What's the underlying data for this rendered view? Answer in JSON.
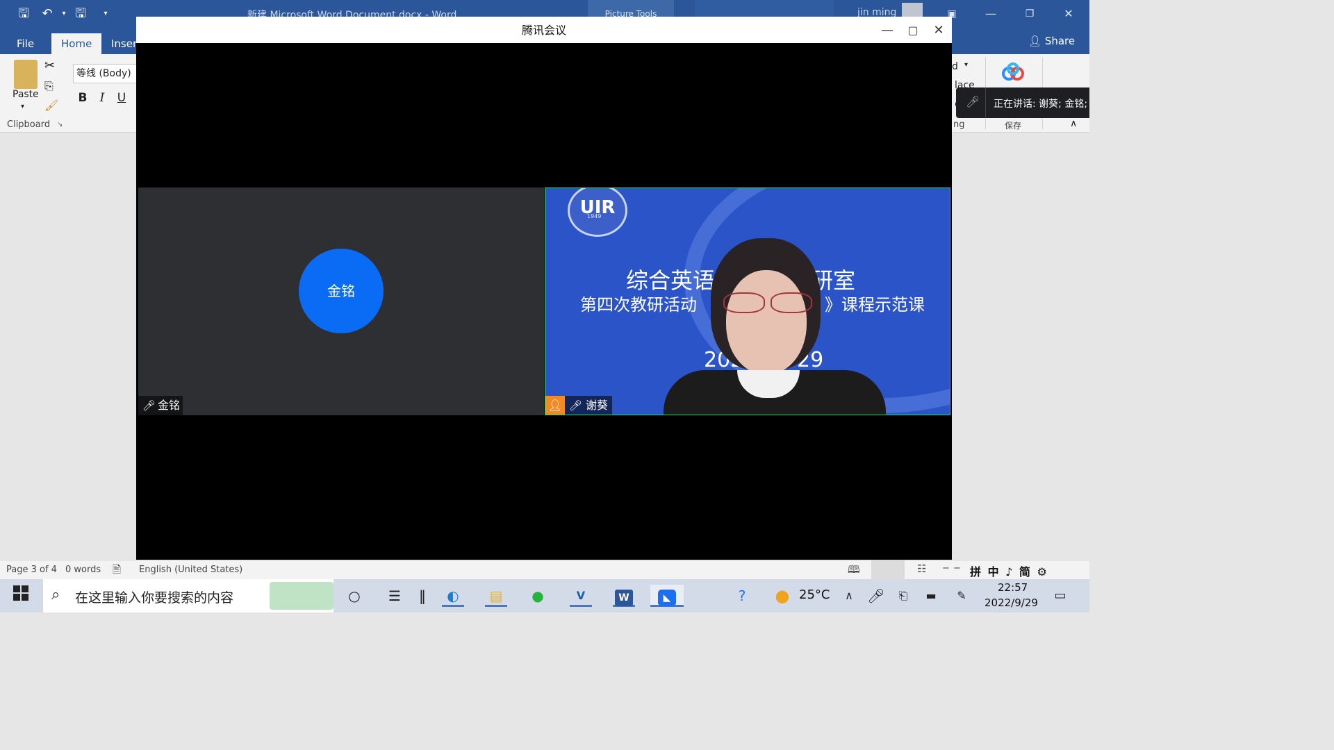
{
  "word": {
    "title": "新建 Microsoft Word Document.docx  -  Word",
    "picture_tools": "Picture Tools",
    "user": "jin ming",
    "tabs": [
      "File",
      "Home",
      "Insert"
    ],
    "share": "Share",
    "paste": "Paste",
    "font_name": "等线 (Body)",
    "bold": "B",
    "italic": "I",
    "underline": "U",
    "clipboard_group": "Clipboard",
    "ribbon_right_fragments": [
      "d",
      "lace",
      "e",
      "ng"
    ],
    "save_cloud": "保存"
  },
  "meeting": {
    "title": "腾讯会议",
    "speaking": "正在讲话: 谢葵; 金铭;",
    "participants": [
      {
        "name": "金铭",
        "avatar_text": "金铭"
      },
      {
        "name": "谢葵"
      }
    ],
    "slide": {
      "logo": "UIR",
      "logo_year": "1949",
      "line1": "综合英语",
      "line1_right": "研室",
      "line2_left": "第四次教研活动",
      "line2_right": "》课程示范课",
      "date_left": "202",
      "date_right": "29"
    }
  },
  "statusbar": {
    "page": "Page 3 of 4",
    "words": "0 words",
    "language": "English (United States)",
    "ime": "拼 中 ♪ 简 ⚙"
  },
  "taskbar": {
    "search_placeholder": "在这里输入你要搜索的内容",
    "weather_temp": "25°C",
    "time": "22:57",
    "date": "2022/9/29"
  },
  "icons": [
    "windows-icon",
    "search-icon",
    "cortana-icon",
    "task-view-icon",
    "edge-icon",
    "file-explorer-icon",
    "wechat-icon",
    "vscode-icon",
    "word-icon",
    "tencent-meeting-icon",
    "help-icon",
    "weather-icon",
    "mic-icon",
    "battery-icon",
    "notification-icon"
  ]
}
